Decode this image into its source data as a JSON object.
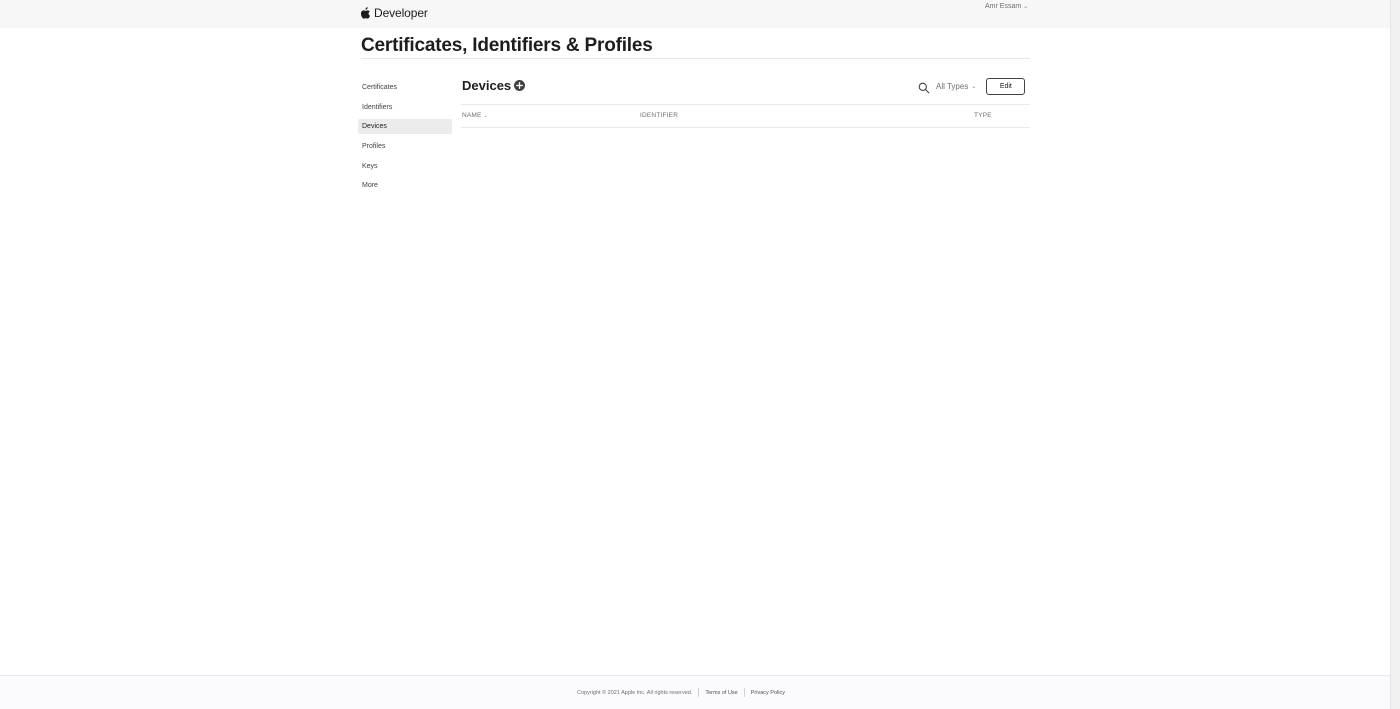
{
  "header": {
    "brand_label": "Developer",
    "account_name": "Amr Essam"
  },
  "page": {
    "title": "Certificates, Identifiers & Profiles"
  },
  "sidebar": {
    "items": [
      {
        "label": "Certificates",
        "active": false
      },
      {
        "label": "Identifiers",
        "active": false
      },
      {
        "label": "Devices",
        "active": true
      },
      {
        "label": "Profiles",
        "active": false
      },
      {
        "label": "Keys",
        "active": false
      },
      {
        "label": "More",
        "active": false
      }
    ]
  },
  "section": {
    "title": "Devices",
    "filter_label": "All Types",
    "edit_label": "Edit"
  },
  "table": {
    "columns": [
      "NAME",
      "IDENTIFIER",
      "TYPE"
    ],
    "rows": []
  },
  "footer": {
    "copyright": "Copyright © 2021 Apple Inc. All rights reserved.",
    "terms_label": "Terms of Use",
    "privacy_label": "Privacy Policy"
  },
  "colors": {
    "accent": "#1d1d1f",
    "muted": "#6e6e73",
    "active_bg": "#ececee"
  }
}
